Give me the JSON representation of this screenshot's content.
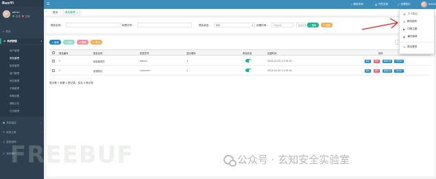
{
  "sidebar": {
    "logo": "RuoYi",
    "user": {
      "name": "admin",
      "status_online": "在线",
      "status_logout": "注销"
    },
    "items": [
      {
        "label": "首页",
        "icon": "home-icon"
      },
      {
        "label": "系统管理",
        "icon": "gear-icon",
        "active": true
      },
      {
        "label": "系统监控",
        "icon": "monitor-icon"
      },
      {
        "label": "系统工具",
        "icon": "wrench-icon"
      },
      {
        "label": "若依官网",
        "icon": "globe-icon"
      },
      {
        "label": "实例演示",
        "icon": "desktop-icon"
      }
    ],
    "subitems": [
      "用户管理",
      "角色管理",
      "菜单管理",
      "部门管理",
      "岗位管理",
      "字典管理",
      "参数设置",
      "通知公告",
      "日志管理"
    ]
  },
  "topbar": {
    "links": [
      "使用手册",
      "开发文档",
      "全屏显示"
    ],
    "user": "admin"
  },
  "tabs": {
    "home": "首页",
    "current": "角色管理"
  },
  "search": {
    "role_name_label": "角色名称：",
    "role_key_label": "权限字符：",
    "status_label": "角色状态：",
    "status_value": "所有",
    "create_time_label": "创建时间：",
    "start_placeholder": "开始时间",
    "end_placeholder": "结束时间",
    "search_btn": "搜索",
    "reset_btn": "重置"
  },
  "toolbar": {
    "add": "新增",
    "edit": "修改",
    "delete": "删除",
    "export": "导出"
  },
  "table": {
    "headers": [
      "角色编号",
      "角色名称",
      "权限字符",
      "显示顺序",
      "角色状态",
      "创建时间",
      "操作"
    ],
    "rows": [
      {
        "id": "1",
        "name": "超级管理员",
        "key": "admin",
        "order": "1",
        "time": "2024-01-02 11:35:41"
      },
      {
        "id": "2",
        "name": "普通角色",
        "key": "common",
        "order": "2",
        "time": "2024-01-02 11:35:41"
      }
    ],
    "actions": [
      "编辑",
      "删除",
      "数据权限",
      "分配用户"
    ],
    "pager": "显示第 1 到第 2 条记录，总共 2 条记录"
  },
  "dropdown": {
    "items": [
      "个人中心",
      "修改密码",
      "切换主题",
      "横向菜单",
      "退出登录"
    ]
  },
  "watermark": {
    "brand": "FREEBUF",
    "channel": "公众号 · 玄知安全实验室"
  },
  "colors": {
    "sidebar": "#2f4050",
    "topbar": "#3c8dbc",
    "accent": "#1ab394",
    "arrow": "#e02020"
  }
}
